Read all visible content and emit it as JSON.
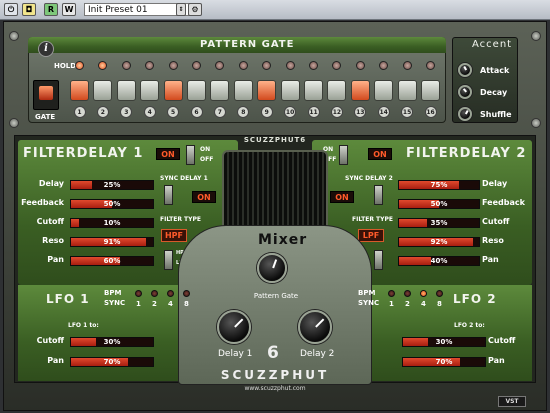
{
  "host": {
    "preset": "Init Preset 01",
    "btn_w": "W",
    "btn_r": "R"
  },
  "pattern": {
    "title": "PATTERN GATE",
    "hold": "HOLD",
    "gate": "GATE",
    "info": "i",
    "holds": [
      true,
      true,
      false,
      false,
      false,
      false,
      false,
      false,
      false,
      false,
      false,
      false,
      false,
      false,
      false,
      false
    ],
    "keys": [
      true,
      false,
      false,
      false,
      true,
      false,
      false,
      false,
      true,
      false,
      false,
      false,
      true,
      false,
      false,
      false
    ],
    "numbers": [
      "1",
      "2",
      "3",
      "4",
      "5",
      "6",
      "7",
      "8",
      "9",
      "10",
      "11",
      "12",
      "13",
      "14",
      "15",
      "16"
    ]
  },
  "accent": {
    "title": "Accent",
    "attack": "Attack",
    "decay": "Decay",
    "shuffle": "Shuffle"
  },
  "brand": {
    "header": "SCUZZPHUT6",
    "name": "SCUZZPHUT",
    "url": "www.scuzzphut.com",
    "numeral": "6"
  },
  "fd1": {
    "title": "FILTERDELAY 1",
    "on": "ON",
    "off": "OFF",
    "sync_label": "SYNC DELAY 1",
    "sync_on": "ON",
    "filter_type_label": "FILTER TYPE",
    "filter_type": "HPF",
    "hp": "HP",
    "lp": "LP",
    "params": [
      {
        "label": "Delay",
        "value": "25%",
        "level": 0.25
      },
      {
        "label": "Feedback",
        "value": "50%",
        "level": 0.5
      },
      {
        "label": "Cutoff",
        "value": "10%",
        "level": 0.1
      },
      {
        "label": "Reso",
        "value": "91%",
        "level": 0.91
      },
      {
        "label": "Pan",
        "value": "60%",
        "level": 0.6
      }
    ]
  },
  "fd2": {
    "title": "FILTERDELAY 2",
    "on": "ON",
    "off": "OFF",
    "sync_label": "SYNC DELAY 2",
    "sync_on": "ON",
    "filter_type_label": "FILTER TYPE",
    "filter_type": "LPF",
    "hp": "HP",
    "lp": "LP",
    "params": [
      {
        "label": "Delay",
        "value": "75%",
        "level": 0.75
      },
      {
        "label": "Feedback",
        "value": "50%",
        "level": 0.5
      },
      {
        "label": "Cutoff",
        "value": "35%",
        "level": 0.35
      },
      {
        "label": "Reso",
        "value": "92%",
        "level": 0.92
      },
      {
        "label": "Pan",
        "value": "40%",
        "level": 0.4
      }
    ]
  },
  "mixer": {
    "title": "Mixer",
    "pattern_gate": "Pattern Gate",
    "delay1": "Delay 1",
    "delay2": "Delay 2"
  },
  "lfo1": {
    "title": "LFO 1",
    "bpm": "BPM",
    "sync": "SYNC",
    "opts": [
      "1",
      "2",
      "4",
      "8"
    ],
    "selected": -1,
    "to": "LFO 1 to:",
    "params": [
      {
        "label": "Cutoff",
        "value": "30%",
        "level": 0.3
      },
      {
        "label": "Pan",
        "value": "70%",
        "level": 0.7
      }
    ]
  },
  "lfo2": {
    "title": "LFO 2",
    "bpm": "BPM",
    "sync": "SYNC",
    "opts": [
      "1",
      "2",
      "4",
      "8"
    ],
    "selected": 2,
    "to": "LFO 2 to:",
    "params": [
      {
        "label": "Cutoff",
        "value": "30%",
        "level": 0.3
      },
      {
        "label": "Pan",
        "value": "70%",
        "level": 0.7
      }
    ]
  },
  "footer": {
    "vst": "VST"
  }
}
